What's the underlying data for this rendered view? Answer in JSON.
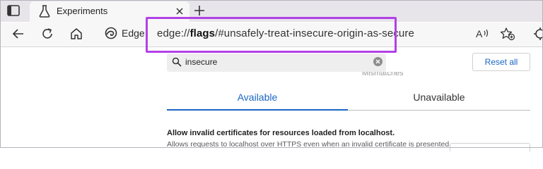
{
  "tab": {
    "title": "Experiments"
  },
  "toolbar": {
    "brand_label": "Edge",
    "url_prefix": "edge://",
    "url_bold": "flags",
    "url_suffix": "/#unsafely-treat-insecure-origin-as-secure"
  },
  "search": {
    "value": "insecure"
  },
  "reset_label": "Reset all",
  "partial_hidden_text": "Mismatches",
  "tabs": [
    {
      "label": "Available",
      "active": true
    },
    {
      "label": "Unavailable",
      "active": false
    }
  ],
  "flag": {
    "title": "Allow invalid certificates for resources loaded from localhost.",
    "description": "Allows requests to localhost over HTTPS even when an invalid certificate is presented. –"
  },
  "colors": {
    "highlight": "#b341e6",
    "accent": "#1a66c5"
  },
  "icons": [
    "sidebar-toggle-icon",
    "flask-icon",
    "close-icon",
    "plus-icon",
    "back-icon",
    "refresh-icon",
    "home-icon",
    "edge-logo-icon",
    "read-aloud-icon",
    "favorites-icon",
    "extensions-icon",
    "search-icon",
    "clear-icon"
  ]
}
